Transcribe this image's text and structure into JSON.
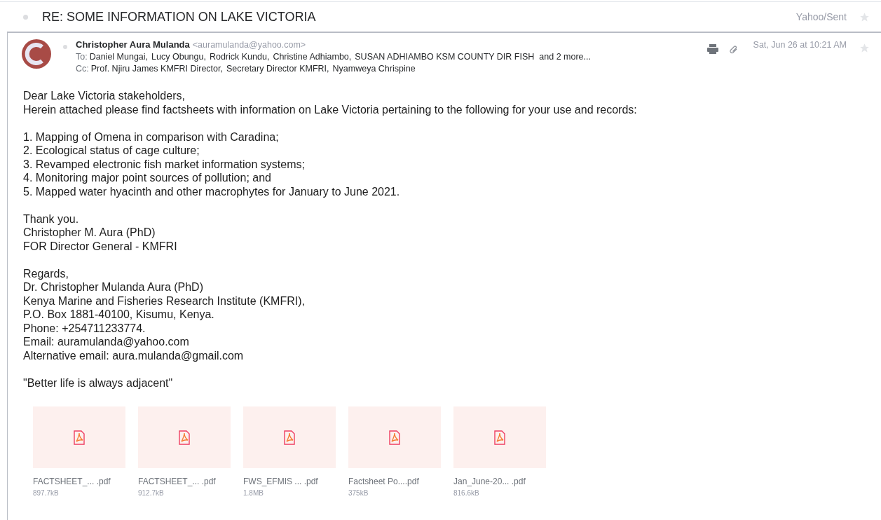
{
  "subject": "RE: SOME INFORMATION ON LAKE VICTORIA",
  "folder": "Yahoo/Sent",
  "thread_starred": false,
  "message": {
    "from_name": "Christopher Aura Mulanda",
    "from_email": "<auramulanda@yahoo.com>",
    "to_label": "To:",
    "to": [
      "Daniel Mungai,",
      "Lucy Obungu,",
      "Rodrick Kundu,",
      "Christine Adhiambo,",
      "SUSAN ADHIAMBO KSM COUNTY DIR FISH"
    ],
    "to_more": "and 2 more...",
    "cc_label": "Cc:",
    "cc": [
      "Prof. Njiru James KMFRI Director,",
      "Secretary Director KMFRI,",
      "Nyamweya Chrispine"
    ],
    "date": "Sat, Jun 26 at 10:21 AM",
    "starred": false,
    "body": [
      [
        "Dear Lake Victoria stakeholders,",
        "Herein attached please find factsheets with information on Lake Victoria pertaining to the following for your use and records:"
      ],
      [
        "1. Mapping of Omena in comparison with Caradina;",
        "2. Ecological status of cage culture;",
        "3. Revamped electronic fish market information systems;",
        "4. Monitoring major point sources of pollution; and",
        "5. Mapped water hyacinth and other macrophytes for January to June 2021."
      ],
      [
        "Thank you.",
        "Christopher M. Aura (PhD)",
        "FOR Director General - KMFRI"
      ],
      [
        "Regards,",
        "Dr. Christopher Mulanda Aura (PhD)",
        "Kenya Marine and Fisheries Research Institute (KMFRI),",
        "P.O. Box 1881-40100, Kisumu, Kenya.",
        "Phone: +254711233774.",
        "Email: auramulanda@yahoo.com",
        "Alternative email: aura.mulanda@gmail.com"
      ],
      [
        "\"Better life is always adjacent\""
      ]
    ],
    "attachments": [
      {
        "name": "FACTSHEET_... .pdf",
        "size": "897.7kB"
      },
      {
        "name": "FACTSHEET_... .pdf",
        "size": "912.7kB"
      },
      {
        "name": "FWS_EFMIS ... .pdf",
        "size": "1.8MB"
      },
      {
        "name": "Factsheet Po....pdf",
        "size": "375kB"
      },
      {
        "name": "Jan_June-20... .pdf",
        "size": "816.6kB"
      }
    ]
  }
}
